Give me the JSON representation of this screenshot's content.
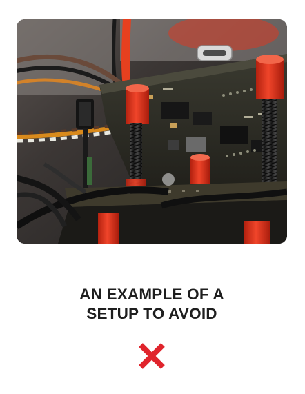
{
  "photo": {
    "subject": "hardware-setup-photo"
  },
  "caption": {
    "line1": "AN EXAMPLE OF A",
    "line2": "SETUP TO AVOID"
  },
  "status": {
    "icon": "cross-icon",
    "color": "#e0242c"
  },
  "colors": {
    "accent_red": "#e0242c",
    "standoff_red": "#e63a1f",
    "pcb_dark": "#2c2a24",
    "text": "#1e1e1e"
  }
}
